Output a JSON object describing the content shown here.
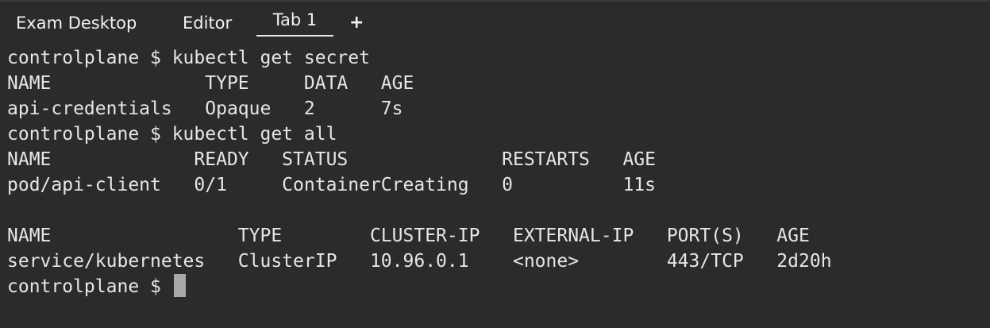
{
  "tabs": {
    "exam_desktop": "Exam Desktop",
    "editor": "Editor",
    "tab1": "Tab 1",
    "add": "+"
  },
  "terminal": {
    "lines": [
      "controlplane $ kubectl get secret",
      "NAME              TYPE     DATA   AGE",
      "api-credentials   Opaque   2      7s",
      "controlplane $ kubectl get all",
      "NAME             READY   STATUS              RESTARTS   AGE",
      "pod/api-client   0/1     ContainerCreating   0          11s",
      "",
      "NAME                 TYPE        CLUSTER-IP   EXTERNAL-IP   PORT(S)   AGE",
      "service/kubernetes   ClusterIP   10.96.0.1    <none>        443/TCP   2d20h"
    ],
    "prompt": "controlplane $ "
  }
}
